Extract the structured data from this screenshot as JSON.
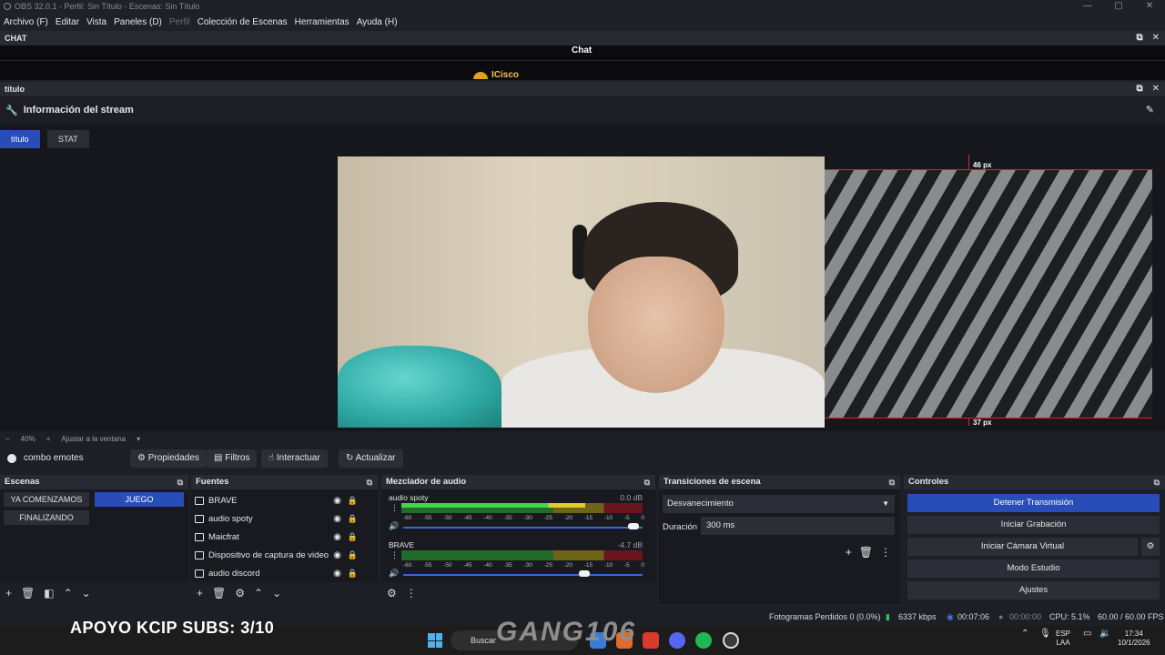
{
  "window": {
    "title": "OBS 32.0.1 - Perfil: Sin Título - Escenas: Sin Título",
    "controls": [
      "—",
      "▢",
      "✕"
    ]
  },
  "menu": [
    "Archivo (F)",
    "Editar",
    "Vista",
    "Paneles (D)",
    "Perfil",
    "Colección de Escenas",
    "Herramientas",
    "Ayuda (H)"
  ],
  "chat_dock": {
    "header": "CHAT",
    "title": "Chat",
    "user": "ICisco"
  },
  "titulo_dock": {
    "header": "título"
  },
  "stream_info": {
    "title": "Información del stream"
  },
  "tabs": [
    {
      "label": "título",
      "active": true
    },
    {
      "label": "STAT",
      "active": false
    }
  ],
  "preview": {
    "top_px": "46 px",
    "bottom_px": "37 px",
    "zoom": "40%",
    "fit": "Ajustar a la ventana"
  },
  "source_toolbar": {
    "name": "combo emotes",
    "buttons": [
      "Propiedades",
      "Filtros",
      "Interactuar",
      "Actualizar"
    ]
  },
  "scenes": {
    "header": "Escenas",
    "items": [
      {
        "label": "YA COMENZAMOS",
        "active": false
      },
      {
        "label": "JUEGO",
        "active": true
      },
      {
        "label": "FINALIZANDO",
        "active": false
      }
    ]
  },
  "sources": {
    "header": "Fuentes",
    "items": [
      "BRAVE",
      "audio spoty",
      "Maicfrat",
      "Dispositivo de captura de video",
      "audio discord"
    ]
  },
  "mixer": {
    "header": "Mezclador de audio",
    "scale": [
      "-60",
      "-55",
      "-50",
      "-45",
      "-40",
      "-35",
      "-30",
      "-25",
      "-20",
      "-15",
      "-10",
      "-5",
      "0"
    ],
    "channels": [
      {
        "name": "audio spoty",
        "db": "0.0 dB",
        "level": 0.78,
        "fader": 1.0
      },
      {
        "name": "BRAVE",
        "db": "-4.7 dB",
        "level": 0.0,
        "fader": 0.78
      }
    ]
  },
  "transitions": {
    "header": "Transiciones de escena",
    "selected": "Desvanecimiento",
    "duration_label": "Duración",
    "duration_value": "300 ms"
  },
  "controls": {
    "header": "Controles",
    "buttons": [
      {
        "label": "Detener Transmisión",
        "primary": true
      },
      {
        "label": "Iniciar Grabación",
        "primary": false
      },
      {
        "label": "Iniciar Cámara Virtual",
        "primary": false
      },
      {
        "label": "Modo Estudio",
        "primary": false
      },
      {
        "label": "Ajustes",
        "primary": false
      }
    ]
  },
  "status": {
    "dropped": "Fotogramas Perdidos 0 (0.0%)",
    "bitrate": "6337 kbps",
    "stream_time": "00:07:06",
    "rec_time": "00:00:00",
    "cpu": "CPU: 5.1%",
    "fps": "60.00 / 60.00 FPS"
  },
  "overlay": {
    "subs": "APOYO KCIP SUBS: 3/10",
    "logo": "GANG106"
  },
  "taskbar": {
    "search": "Buscar",
    "lang_top": "ESP",
    "lang_bottom": "LAA",
    "time": "17:34",
    "date": "10/1/2026"
  }
}
